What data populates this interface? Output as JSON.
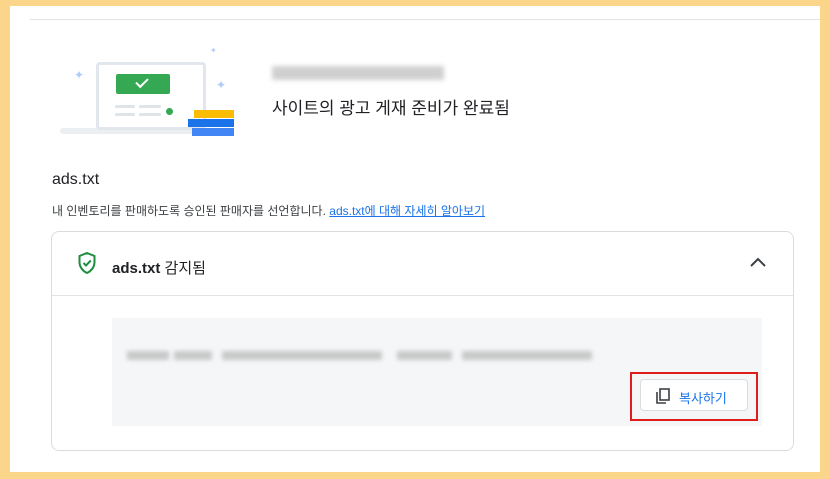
{
  "summary": {
    "status_text": "사이트의 광고 게재 준비가 완료됨"
  },
  "ads_txt": {
    "title": "ads.txt",
    "description": "내 인벤토리를 판매하도록 승인된 판매자를 선언합니다.",
    "learn_more_link": "ads.txt에 대해 자세히 알아보기",
    "card": {
      "status_prefix": "ads.txt",
      "status_suffix": " 감지됨",
      "copy_button_label": "복사하기"
    }
  },
  "colors": {
    "frame_border": "#fbd58a",
    "success_green": "#34a853",
    "link_blue": "#1a73e8",
    "highlight_red": "#e01c1c"
  },
  "icons": {
    "status": "shield-check-icon",
    "collapse": "chevron-up-icon",
    "copy": "copy-icon"
  }
}
